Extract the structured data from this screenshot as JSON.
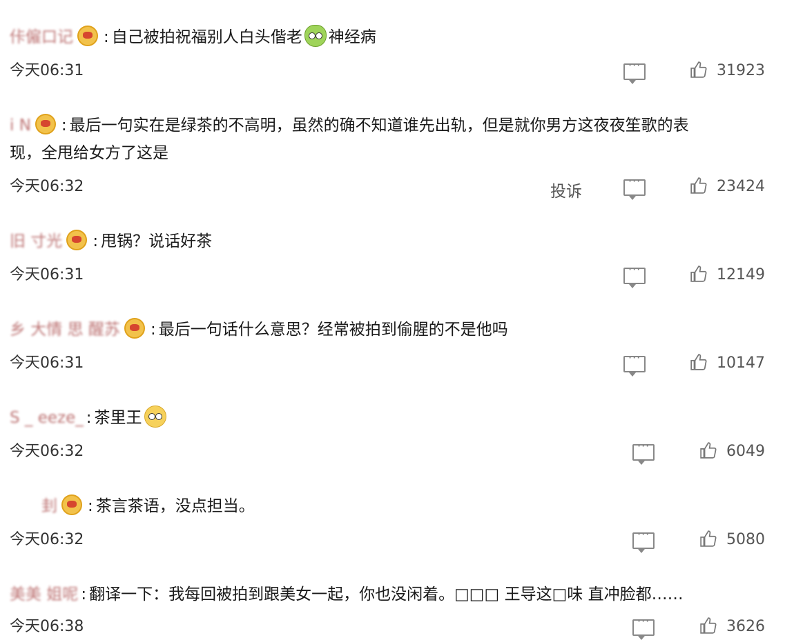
{
  "comments": [
    {
      "username": "佧僱口记",
      "text": "自己被拍祝福别人白头偕老",
      "text_after_emoji": "神经病",
      "time": "今天06:31",
      "likes": "31923"
    },
    {
      "username": "i             N",
      "text_line1": "最后一句实在是绿茶的不高明，虽然的确不知道谁先出轨，但是就你男方这夜夜笙歌的表",
      "text_line2": "现，全甩给女方了这是",
      "time": "今天06:32",
      "report": "投诉",
      "likes": "23424"
    },
    {
      "username": "旧                  寸光",
      "text": "甩锅？说话好茶",
      "time": "今天06:31",
      "likes": "12149"
    },
    {
      "username": "乡 大情 思 醒苏",
      "text": "最后一句话什么意思？经常被拍到偷腥的不是他吗",
      "time": "今天06:31",
      "likes": "10147"
    },
    {
      "username": "S                    _  eeze_",
      "text": "茶里王",
      "time": "今天06:32",
      "likes": "6049"
    },
    {
      "username": "刲",
      "text": "茶言茶语，没点担当。",
      "time": "今天06:32",
      "likes": "5080"
    },
    {
      "username": "美美   姐呢",
      "text": "翻译一下：我每回被拍到跟美女一起，你也没闲着。□□□ 王导这□味 直冲脸都……",
      "time": "今天06:38",
      "likes": "3626"
    }
  ],
  "colors": {
    "username": "#b25c5c",
    "text": "#1a1a1a",
    "meta": "#555555"
  },
  "icons": {
    "comment": "comment-icon",
    "like": "thumbs-up-icon",
    "badge": "member-badge-icon"
  }
}
